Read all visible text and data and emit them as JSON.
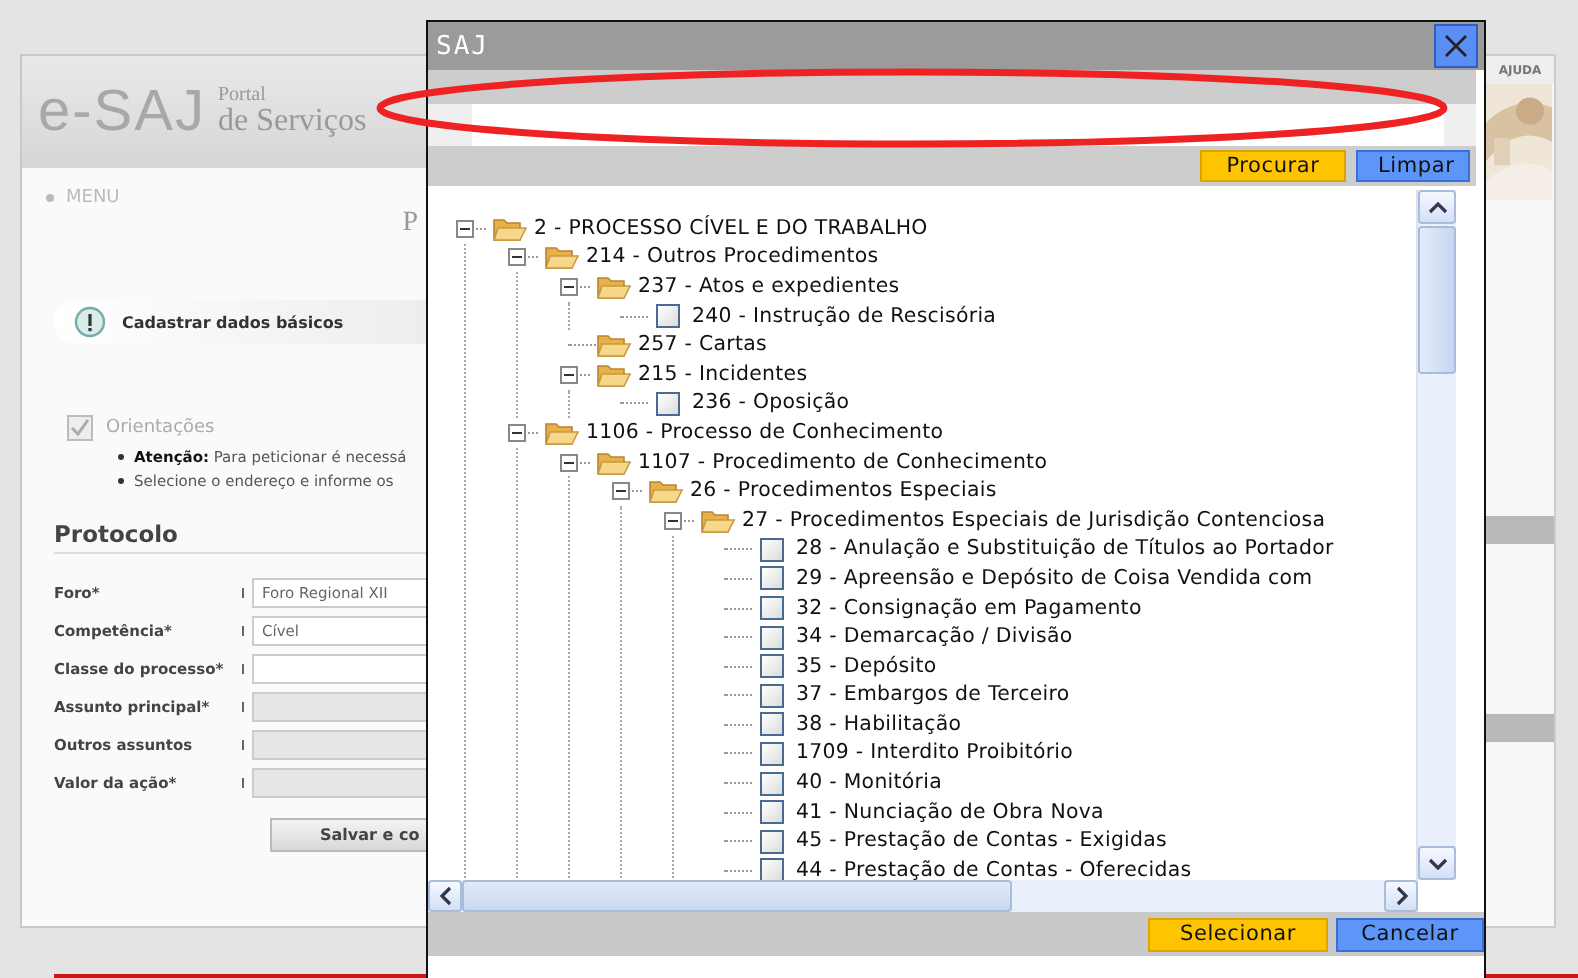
{
  "background_page": {
    "logo": {
      "mark": "e-SAJ",
      "line_1": "Portal",
      "line_2": "de Serviços"
    },
    "menu": "MENU",
    "heading": "P",
    "step": "Cadastrar dados básicos",
    "guidance": {
      "title": "Orientações",
      "bullets": [
        "**Atenção:** Para peticionar é necessá",
        "Selecione o endereço e informe os"
      ]
    },
    "form": {
      "title": "Protocolo",
      "fields": [
        {
          "label": "Foro*",
          "value": "Foro Regional XII",
          "disabled": false
        },
        {
          "label": "Competência*",
          "value": "Cível",
          "disabled": false
        },
        {
          "label": "Classe do processo*",
          "disabled": false
        },
        {
          "label": "Assunto principal*",
          "disabled": true
        },
        {
          "label": "Outros assuntos",
          "disabled": true
        },
        {
          "label": "Valor da ação*",
          "disabled": true
        }
      ],
      "button": "Salvar e co"
    },
    "side_panel": {
      "title": "AJUDA"
    }
  },
  "dialog": {
    "title": "SAJ",
    "search_buttons": [
      {
        "label": "Procurar",
        "kind": "primary"
      },
      {
        "label": "Limpar",
        "kind": "secondary"
      }
    ],
    "tree": [
      {
        "label": "2 - PROCESSO CÍVEL E DO TRABALHO",
        "kind": "folder",
        "expanded": true,
        "children": [
          {
            "label": "214 - Outros Procedimentos",
            "kind": "folder",
            "expanded": true,
            "children": [
              {
                "label": "237 - Atos e expedientes",
                "kind": "folder",
                "expanded": true,
                "children": [
                  {
                    "label": "240 - Instrução de Rescisória",
                    "kind": "item",
                    "checked": false
                  }
                ]
              },
              {
                "label": "257 - Cartas",
                "kind": "folder"
              },
              {
                "label": "215 - Incidentes",
                "kind": "folder",
                "expanded": true,
                "children": [
                  {
                    "label": "236 - Oposição",
                    "kind": "item",
                    "checked": false
                  }
                ]
              }
            ]
          },
          {
            "label": "1106 - Processo de Conhecimento",
            "kind": "folder",
            "expanded": true,
            "children": [
              {
                "label": "1107 - Procedimento de Conhecimento",
                "kind": "folder",
                "expanded": true,
                "children": [
                  {
                    "label": "26 - Procedimentos Especiais",
                    "kind": "folder",
                    "expanded": true,
                    "children": [
                      {
                        "label": "27 - Procedimentos Especiais de Jurisdição Contenciosa",
                        "kind": "folder",
                        "expanded": true,
                        "children": [
                          {
                            "label": "28 - Anulação e Substituição de Títulos ao Portador",
                            "kind": "item",
                            "checked": false
                          },
                          {
                            "label": "29 - Apreensão e Depósito de Coisa Vendida com",
                            "kind": "item",
                            "checked": false
                          },
                          {
                            "label": "32 - Consignação em Pagamento",
                            "kind": "item",
                            "checked": false
                          },
                          {
                            "label": "34 - Demarcação / Divisão",
                            "kind": "item",
                            "checked": false
                          },
                          {
                            "label": "35 - Depósito",
                            "kind": "item",
                            "checked": false
                          },
                          {
                            "label": "37 - Embargos de Terceiro",
                            "kind": "item",
                            "checked": false
                          },
                          {
                            "label": "38 - Habilitação",
                            "kind": "item",
                            "checked": false
                          },
                          {
                            "label": "1709 - Interdito Proibitório",
                            "kind": "item",
                            "checked": false
                          },
                          {
                            "label": "40 - Monitória",
                            "kind": "item",
                            "checked": false
                          },
                          {
                            "label": "41 - Nunciação de Obra Nova",
                            "kind": "item",
                            "checked": false
                          },
                          {
                            "label": "45 - Prestação de Contas - Exigidas",
                            "kind": "item",
                            "checked": false
                          },
                          {
                            "label": "44 - Prestação de Contas - Oferecidas",
                            "kind": "item",
                            "checked": false
                          }
                        ]
                      }
                    ]
                  }
                ]
              }
            ]
          }
        ]
      }
    ],
    "footer_buttons": [
      {
        "label": "Selecionar",
        "kind": "primary"
      },
      {
        "label": "Cancelar",
        "kind": "secondary"
      }
    ]
  }
}
